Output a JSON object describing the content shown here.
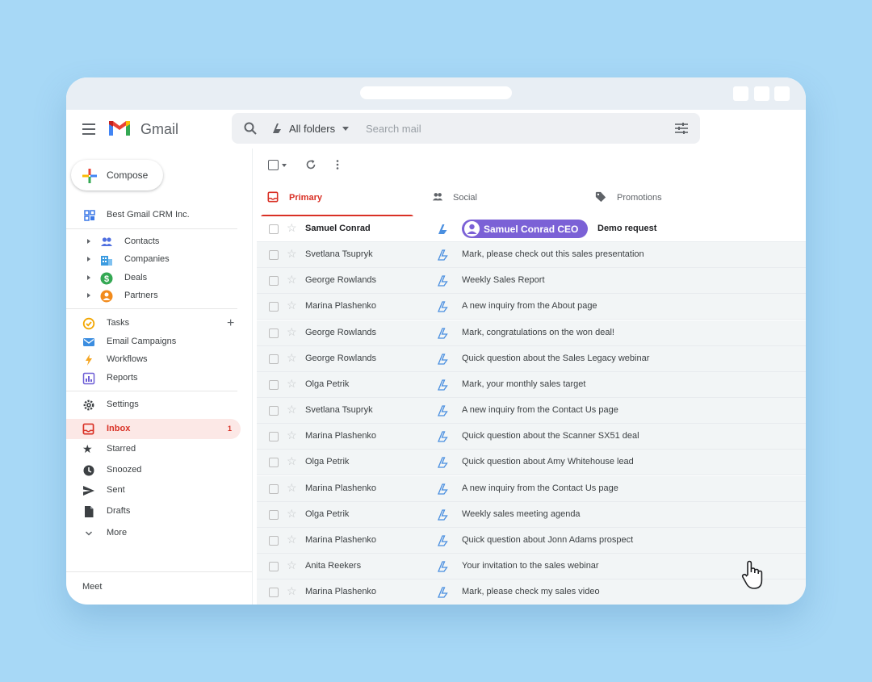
{
  "app": {
    "name": "Gmail"
  },
  "search": {
    "folder_label": "All folders",
    "placeholder": "Search mail"
  },
  "sidebar": {
    "compose_label": "Compose",
    "crm_title": "Best Gmail CRM Inc.",
    "crm_items": [
      {
        "label": "Contacts",
        "icon": "people-icon",
        "color": "#4f6fe0"
      },
      {
        "label": "Companies",
        "icon": "building-icon",
        "color": "#3b9be0"
      },
      {
        "label": "Deals",
        "icon": "dollar-icon",
        "color": "#34a853"
      },
      {
        "label": "Partners",
        "icon": "partner-icon",
        "color": "#f28b1c"
      }
    ],
    "tool_items": [
      {
        "label": "Tasks",
        "icon": "task-icon"
      },
      {
        "label": "Email Campaigns",
        "icon": "email-campaign-icon"
      },
      {
        "label": "Workflows",
        "icon": "lightning-icon"
      },
      {
        "label": "Reports",
        "icon": "reports-icon"
      }
    ],
    "settings_label": "Settings",
    "folders": [
      {
        "label": "Inbox",
        "icon": "inbox-icon",
        "count": "1"
      },
      {
        "label": "Starred",
        "icon": "star-icon"
      },
      {
        "label": "Snoozed",
        "icon": "clock-icon"
      },
      {
        "label": "Sent",
        "icon": "send-icon"
      },
      {
        "label": "Drafts",
        "icon": "draft-icon"
      },
      {
        "label": "More",
        "icon": "chevron-down-icon"
      }
    ],
    "meet_label": "Meet"
  },
  "tabs": [
    {
      "label": "Primary",
      "icon": "inbox-icon"
    },
    {
      "label": "Social",
      "icon": "people-icon"
    },
    {
      "label": "Promotions",
      "icon": "tag-icon"
    }
  ],
  "emails": [
    {
      "sender": "Samuel Conrad",
      "contact_chip": "Samuel Conrad CEO",
      "subject": "Demo request",
      "unread": true
    },
    {
      "sender": "Svetlana Tsupryk",
      "subject": "Mark, please check out this sales presentation",
      "unread": false
    },
    {
      "sender": "George Rowlands",
      "subject": "Weekly Sales Report",
      "unread": false
    },
    {
      "sender": "Marina Plashenko",
      "subject": "A new inquiry from the About page",
      "unread": false
    },
    {
      "sender": "George Rowlands",
      "subject": "Mark, congratulations on the won deal!",
      "unread": false
    },
    {
      "sender": "George Rowlands",
      "subject": "Quick question about the Sales Legacy webinar",
      "unread": false
    },
    {
      "sender": "Olga Petrik",
      "subject": "Mark, your monthly sales target",
      "unread": false
    },
    {
      "sender": "Svetlana Tsupryk",
      "subject": "A new inquiry from the Contact Us page",
      "unread": false
    },
    {
      "sender": "Marina Plashenko",
      "subject": "Quick question about the Scanner SX51 deal",
      "unread": false
    },
    {
      "sender": "Olga Petrik",
      "subject": "Quick question about Amy Whitehouse lead",
      "unread": false
    },
    {
      "sender": "Marina Plashenko",
      "subject": "A new inquiry from the Contact Us page",
      "unread": false
    },
    {
      "sender": "Olga Petrik",
      "subject": "Weekly sales meeting agenda",
      "unread": false
    },
    {
      "sender": "Marina Plashenko",
      "subject": "Quick question about Jonn Adams prospect",
      "unread": false
    },
    {
      "sender": "Anita Reekers",
      "subject": "Your invitation to the sales webinar",
      "unread": false
    },
    {
      "sender": "Marina Plashenko",
      "subject": "Mark, please check my sales video",
      "unread": false
    }
  ],
  "colors": {
    "accent_red": "#d93025",
    "chip_purple": "#7b61d6",
    "background": "#a7d8f6",
    "crm_blue": "#4a8fe0"
  }
}
